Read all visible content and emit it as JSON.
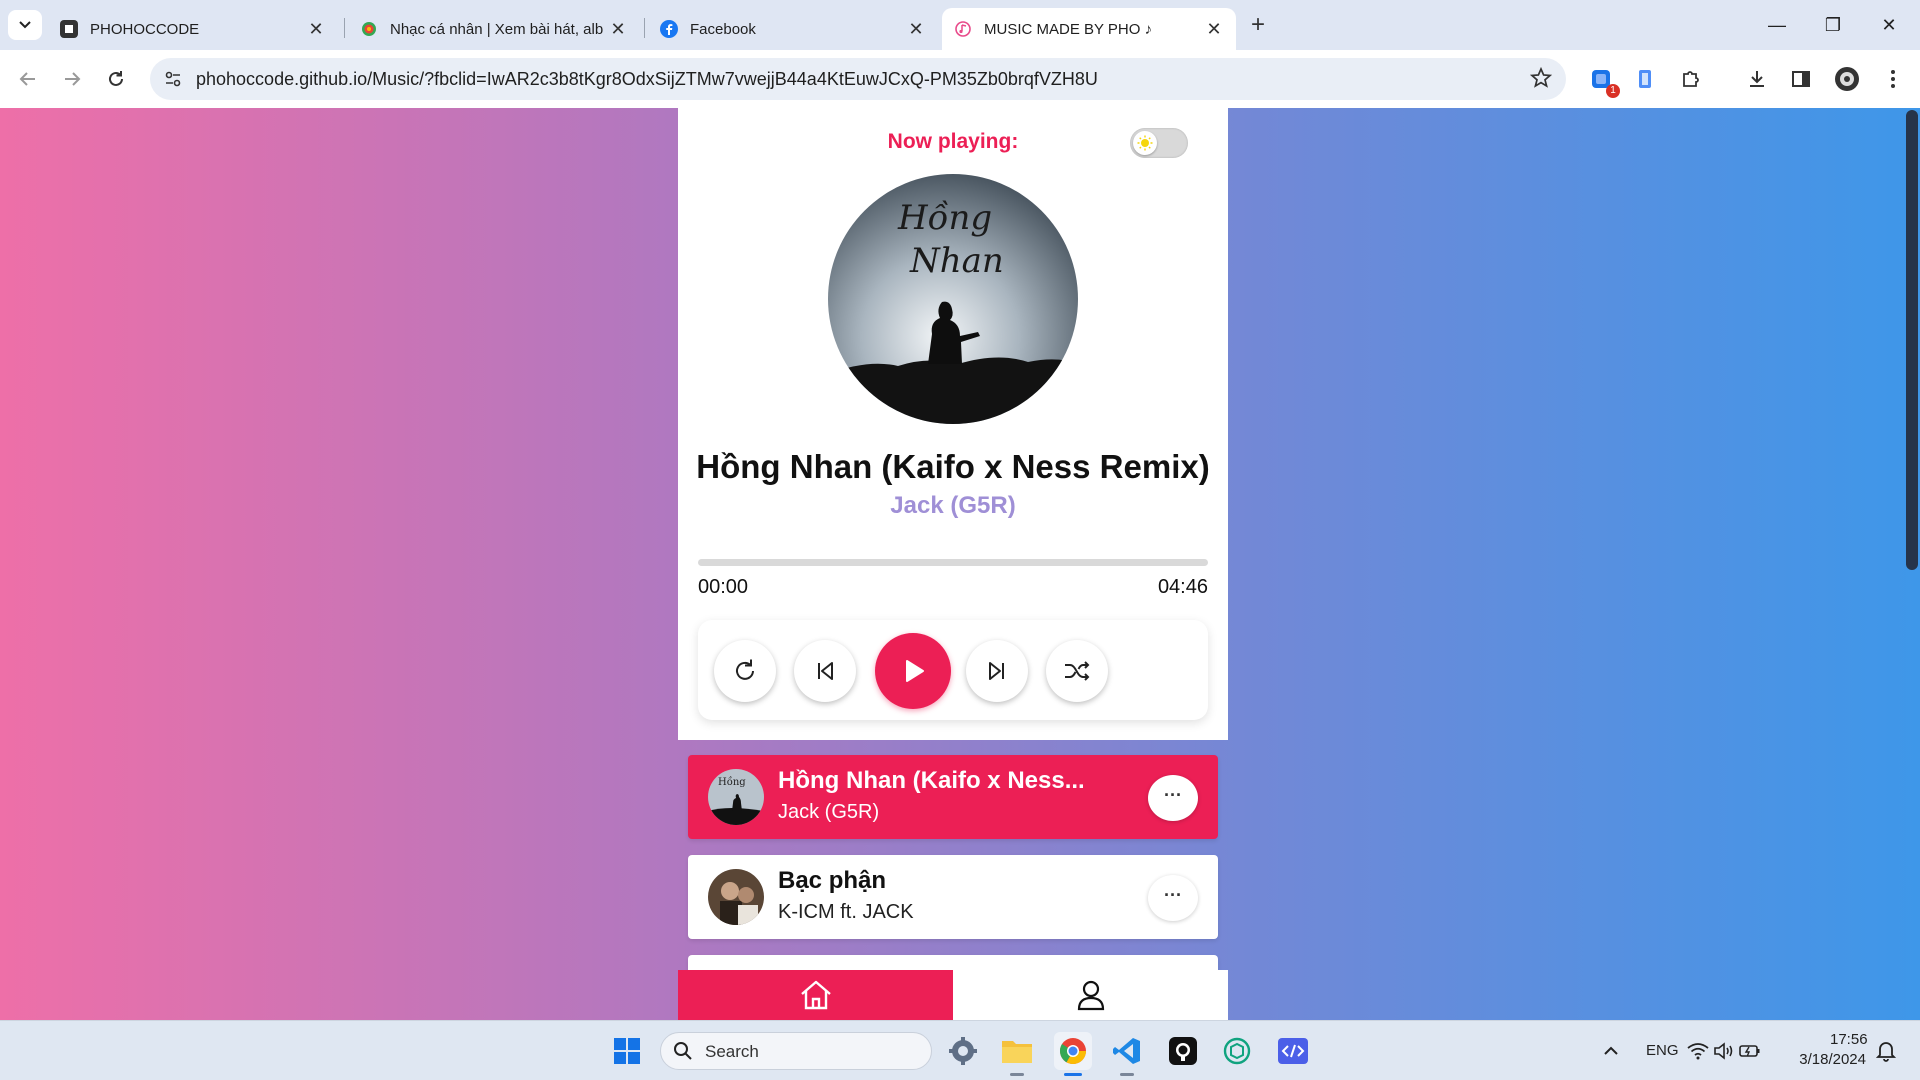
{
  "browser": {
    "tabs": [
      {
        "title": "PHOHOCCODE",
        "icon": "phohoccode-favicon-icon"
      },
      {
        "title": "Nhạc cá nhân | Xem bài hát, alb",
        "icon": "zingmp3-favicon-icon"
      },
      {
        "title": "Facebook",
        "icon": "facebook-favicon-icon"
      },
      {
        "title": "MUSIC MADE BY PHO ♪",
        "icon": "music-favicon-icon",
        "active": true
      }
    ],
    "url": "phohoccode.github.io/Music/?fbclid=IwAR2c3b8tKgr8OdxSijZTMw7vwejjB44a4KtEuwJCxQ-PM35Zb0brqfVZH8U",
    "extension_badge": "1"
  },
  "player": {
    "now_playing_label": "Now playing:",
    "title": "Hồng Nhan (Kaifo x Ness Remix)",
    "artist": "Jack (G5R)",
    "current_time": "00:00",
    "duration": "04:46",
    "progress": 0,
    "cd_art_text": "Hồng Nhan",
    "theme_mode": "light"
  },
  "playlist": [
    {
      "name": "Hồng Nhan (Kaifo x Ness...",
      "artist": "Jack (G5R)",
      "active": true,
      "options": "···"
    },
    {
      "name": "Bạc phận",
      "artist": "K-ICM ft. JACK",
      "active": false,
      "options": "···"
    }
  ],
  "bottom_nav": [
    "home-icon",
    "user-icon"
  ],
  "taskbar": {
    "search_label": "Search",
    "lang": "ENG",
    "time": "17:56",
    "date": "3/18/2024"
  },
  "colors": {
    "accent": "#ec1f55",
    "artist_purple": "#9f8fd6",
    "gradient_left": "#ee6fa8",
    "gradient_right": "#3e97e9"
  }
}
